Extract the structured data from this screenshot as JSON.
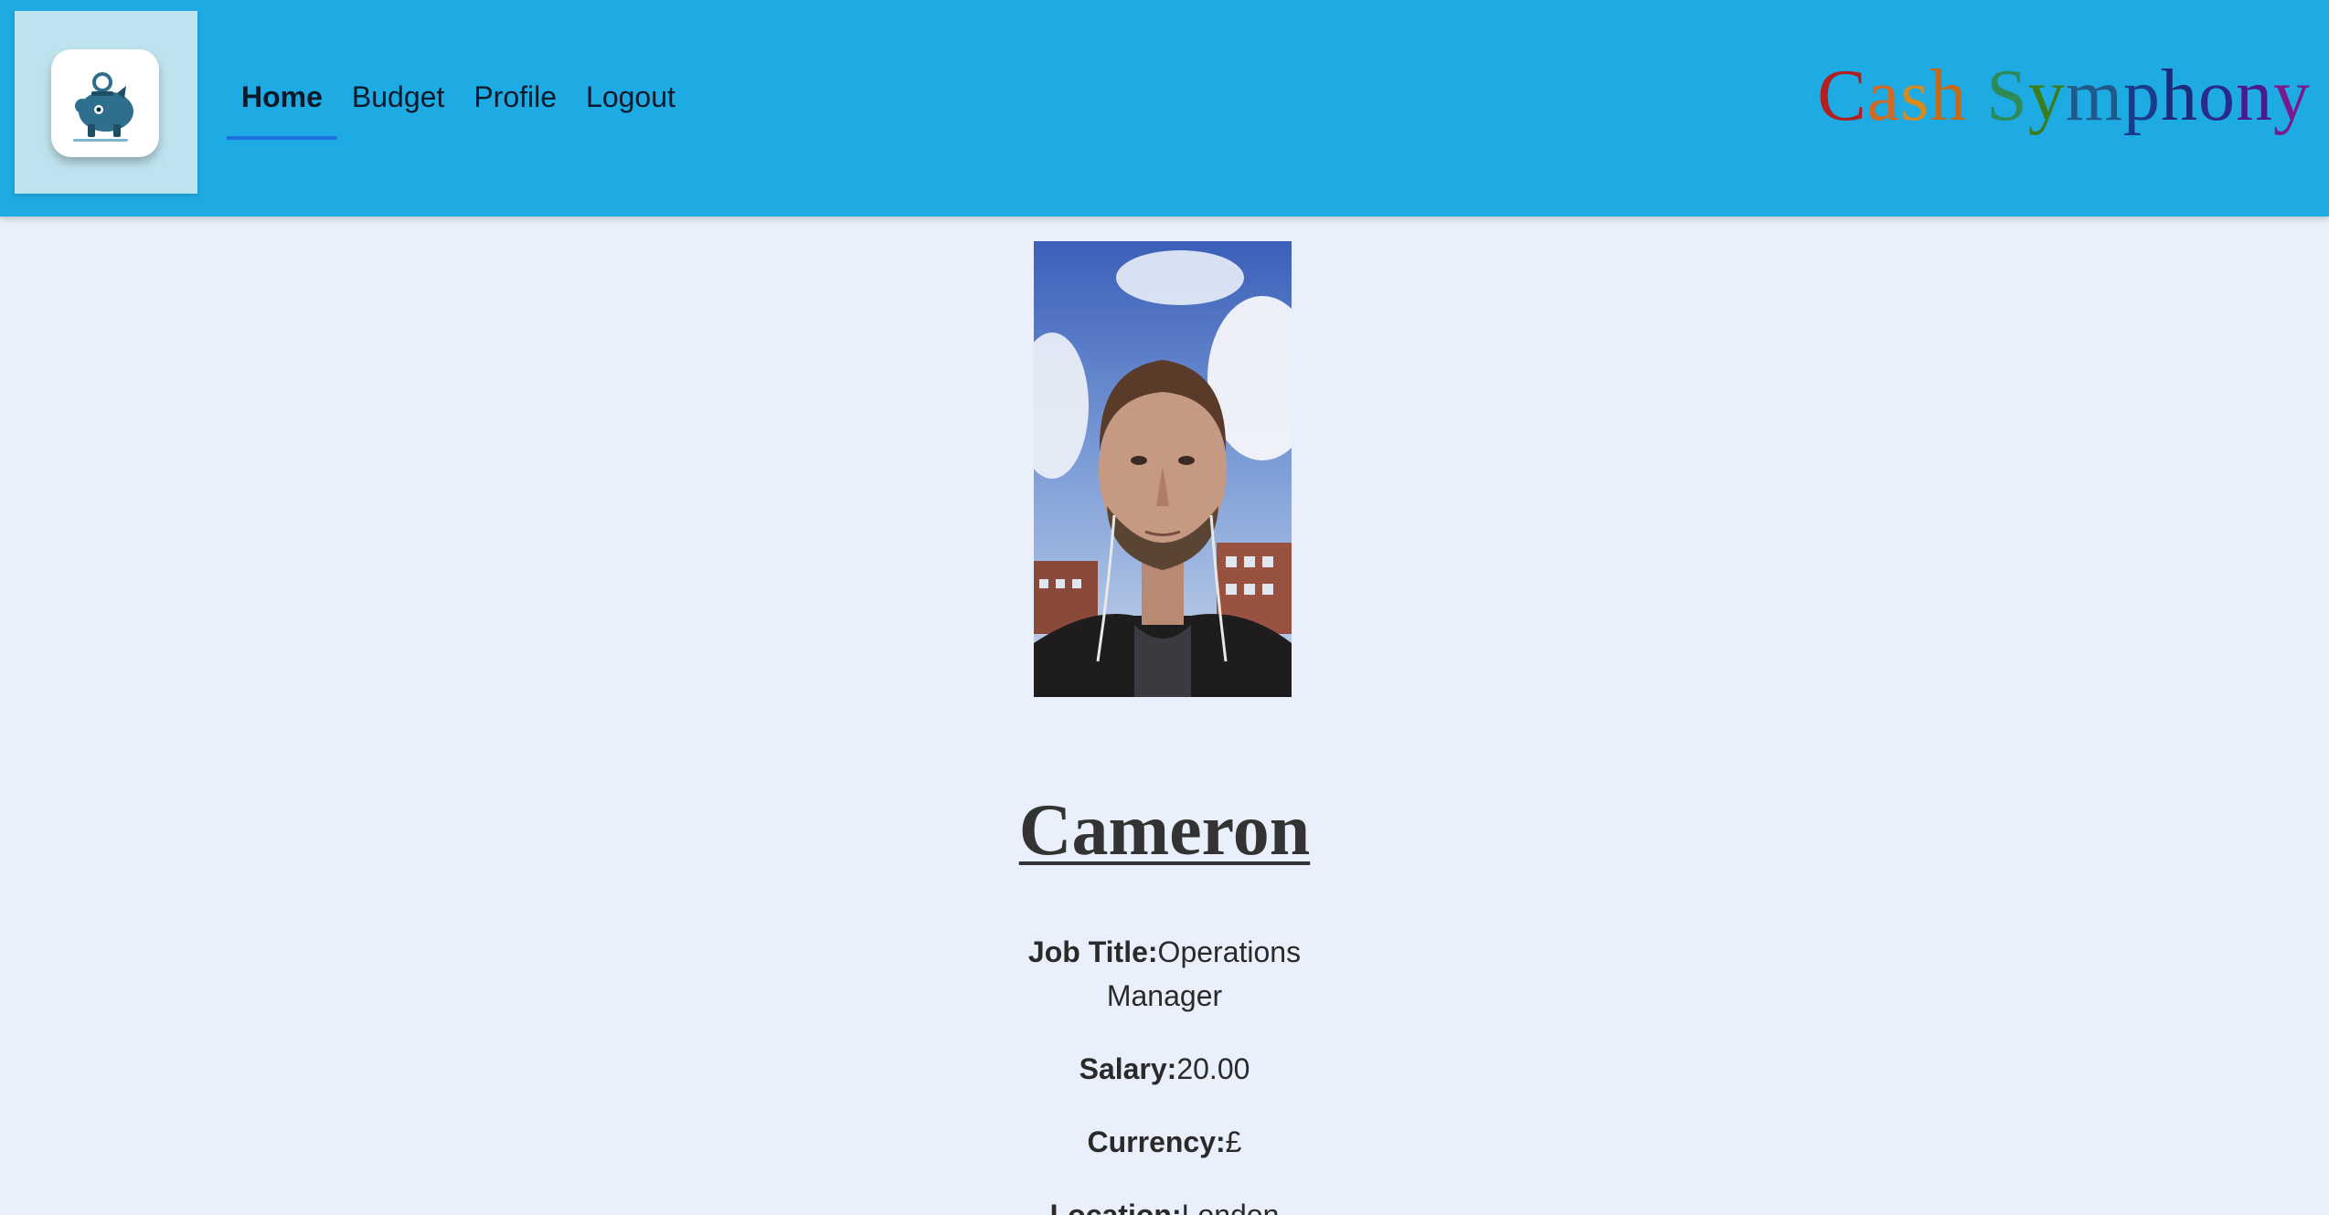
{
  "header": {
    "logo_icon": "piggy-bank-icon",
    "nav": [
      {
        "label": "Home",
        "active": true
      },
      {
        "label": "Budget",
        "active": false
      },
      {
        "label": "Profile",
        "active": false
      },
      {
        "label": "Logout",
        "active": false
      }
    ],
    "brand": "Cash Symphony",
    "brand_colors": [
      "#b21f1f",
      "#d2691e",
      "#d98a1a",
      "#c46a14",
      "#ffffff",
      "#2e8b57",
      "#3a7d1c",
      "#1f5a8a",
      "#1a3a8a",
      "#1c2b7a",
      "#2a2a8c",
      "#4b1a8c",
      "#7a1a8c"
    ]
  },
  "profile": {
    "photo_alt": "profile photo",
    "name": "Cameron",
    "fields": [
      {
        "label": "Job Title:",
        "value": "Operations Manager"
      },
      {
        "label": "Salary:",
        "value": "20.00"
      },
      {
        "label": "Currency:",
        "value": "£"
      },
      {
        "label": "Location:",
        "value": "London"
      }
    ]
  },
  "colors": {
    "header_bg": "#1eaae2",
    "page_bg": "#eaf0fb",
    "active_underline": "#1f6fe0"
  }
}
